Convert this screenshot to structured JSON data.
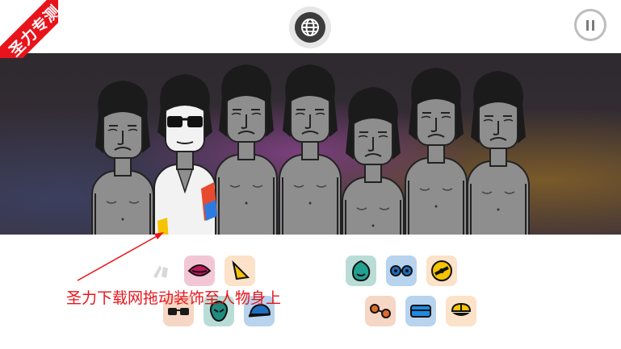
{
  "watermark": {
    "ribbon_text": "圣力专测"
  },
  "hint": {
    "text": "圣力下载网拖动装饰至人物身上"
  },
  "toolbar": {
    "globe": "globe-icon",
    "pause": "pause-icon"
  },
  "characters": [
    {
      "id": "c1",
      "role": "beatbox",
      "active": false
    },
    {
      "id": "c2",
      "role": "dressed-sunglasses",
      "active": true
    },
    {
      "id": "c3",
      "role": "beatbox",
      "active": false
    },
    {
      "id": "c4",
      "role": "beatbox",
      "active": false
    },
    {
      "id": "c5",
      "role": "beatbox",
      "active": false
    },
    {
      "id": "c6",
      "role": "beatbox",
      "active": false
    },
    {
      "id": "c7",
      "role": "beatbox",
      "active": false
    }
  ],
  "sound_icons": [
    {
      "group": "left",
      "name": "used-slot-icon",
      "bg": "#ffffff",
      "fg": "#d0d0d0"
    },
    {
      "group": "left",
      "name": "lips-icon",
      "bg": "#f3c6d6",
      "fg": "#c2185b"
    },
    {
      "group": "left",
      "name": "yellow-horn-icon",
      "bg": "#fbe2c8",
      "fg": "#f5c400"
    },
    {
      "group": "left",
      "name": "sunglasses-icon",
      "bg": "#f6d6c4",
      "fg": "#1a1a1a"
    },
    {
      "group": "left",
      "name": "alien-head-icon",
      "bg": "#b9ddd6",
      "fg": "#1e8c7e"
    },
    {
      "group": "left",
      "name": "blue-cap-icon",
      "bg": "#b7d3ee",
      "fg": "#1f6fc0"
    },
    {
      "group": "right",
      "name": "teal-drop-icon",
      "bg": "#b9ddd6",
      "fg": "#22a091"
    },
    {
      "group": "right",
      "name": "blue-goggles-icon",
      "bg": "#b7d3ee",
      "fg": "#1f6fc0"
    },
    {
      "group": "right",
      "name": "yellow-disc-icon",
      "bg": "#fbe2c8",
      "fg": "#f5c400"
    },
    {
      "group": "right",
      "name": "orange-dots-icon",
      "bg": "#f6d6c4",
      "fg": "#e06b2a"
    },
    {
      "group": "right",
      "name": "blue-box-icon",
      "bg": "#b7d3ee",
      "fg": "#1f8be0"
    },
    {
      "group": "right",
      "name": "yellow-split-icon",
      "bg": "#fbe2c8",
      "fg": "#f5c400"
    }
  ]
}
